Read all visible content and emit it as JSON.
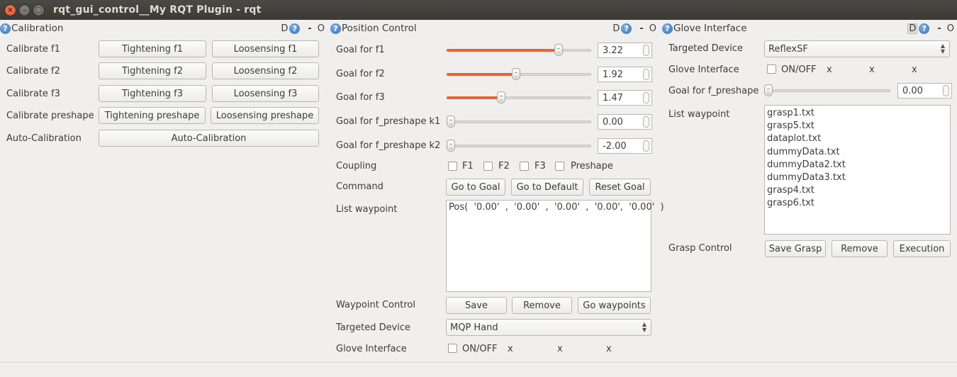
{
  "window": {
    "title": "rqt_gui_control__My RQT Plugin - rqt",
    "buttons": {
      "close": "×",
      "minimize": "–",
      "maximize": "□"
    }
  },
  "dock_controls": {
    "detach": "D",
    "help": "?",
    "minimize": "-",
    "close": "O"
  },
  "calibration": {
    "title": "Calibration",
    "rows": [
      {
        "label": "Calibrate f1",
        "tighten": "Tightening f1",
        "loosen": "Loosensing f1"
      },
      {
        "label": "Calibrate f2",
        "tighten": "Tightening f2",
        "loosen": "Loosensing f2"
      },
      {
        "label": "Calibrate f3",
        "tighten": "Tightening f3",
        "loosen": "Loosensing f3"
      },
      {
        "label": "Calibrate preshape",
        "tighten": "Tightening preshape",
        "loosen": "Loosensing preshape"
      }
    ],
    "auto": {
      "label": "Auto-Calibration",
      "button": "Auto-Calibration"
    }
  },
  "position_control": {
    "title": "Position Control",
    "goals": [
      {
        "label": "Goal for f1",
        "value": "3.22",
        "slider_fraction": 0.79,
        "accent": "#e2663a"
      },
      {
        "label": "Goal for f2",
        "value": "1.92",
        "slider_fraction": 0.48,
        "accent": "#e2663a"
      },
      {
        "label": "Goal for f3",
        "value": "1.47",
        "slider_fraction": 0.37,
        "accent": "#e2663a"
      },
      {
        "label": "Goal for f_preshape k1",
        "value": "0.00",
        "slider_fraction": 0.0
      },
      {
        "label": "Goal for f_preshape k2",
        "value": "-2.00",
        "slider_fraction": 0.0
      }
    ],
    "coupling": {
      "label": "Coupling",
      "options": [
        {
          "label": "F1",
          "checked": false
        },
        {
          "label": "F2",
          "checked": false
        },
        {
          "label": "F3",
          "checked": false
        },
        {
          "label": "Preshape",
          "checked": false
        }
      ]
    },
    "command": {
      "label": "Command",
      "buttons": [
        "Go to Goal",
        "Go to Default",
        "Reset Goal"
      ]
    },
    "list_waypoint": {
      "label": "List waypoint",
      "text": "Pos(  '0.00'  ,  '0.00'  ,  '0.00'  ,  '0.00',  '0.00'  )"
    },
    "waypoint_control": {
      "label": "Waypoint Control",
      "buttons": [
        "Save",
        "Remove",
        "Go waypoints"
      ]
    },
    "targeted_device": {
      "label": "Targeted Device",
      "selected": "MQP Hand"
    },
    "glove_interface": {
      "label": "Glove Interface",
      "checkbox_label": "ON/OFF",
      "checked": false,
      "readouts": [
        "x",
        "x",
        "x"
      ]
    }
  },
  "glove_interface_panel": {
    "title": "Glove Interface",
    "targeted_device": {
      "label": "Targeted Device",
      "selected": "ReflexSF"
    },
    "glove_interface": {
      "label": "Glove Interface",
      "checkbox_label": "ON/OFF",
      "checked": false,
      "readouts": [
        "x",
        "x",
        "x"
      ]
    },
    "goal_preshape": {
      "label": "Goal for f_preshape",
      "value": "0.00",
      "slider_fraction": 0.0
    },
    "list_waypoint": {
      "label": "List waypoint",
      "items": [
        "grasp1.txt",
        "grasp5.txt",
        "dataplot.txt",
        "dummyData.txt",
        "dummyData2.txt",
        "dummyData3.txt",
        "grasp4.txt",
        "grasp6.txt"
      ]
    },
    "grasp_control": {
      "label": "Grasp Control",
      "buttons": [
        "Save Grasp",
        "Remove",
        "Execution"
      ]
    }
  }
}
